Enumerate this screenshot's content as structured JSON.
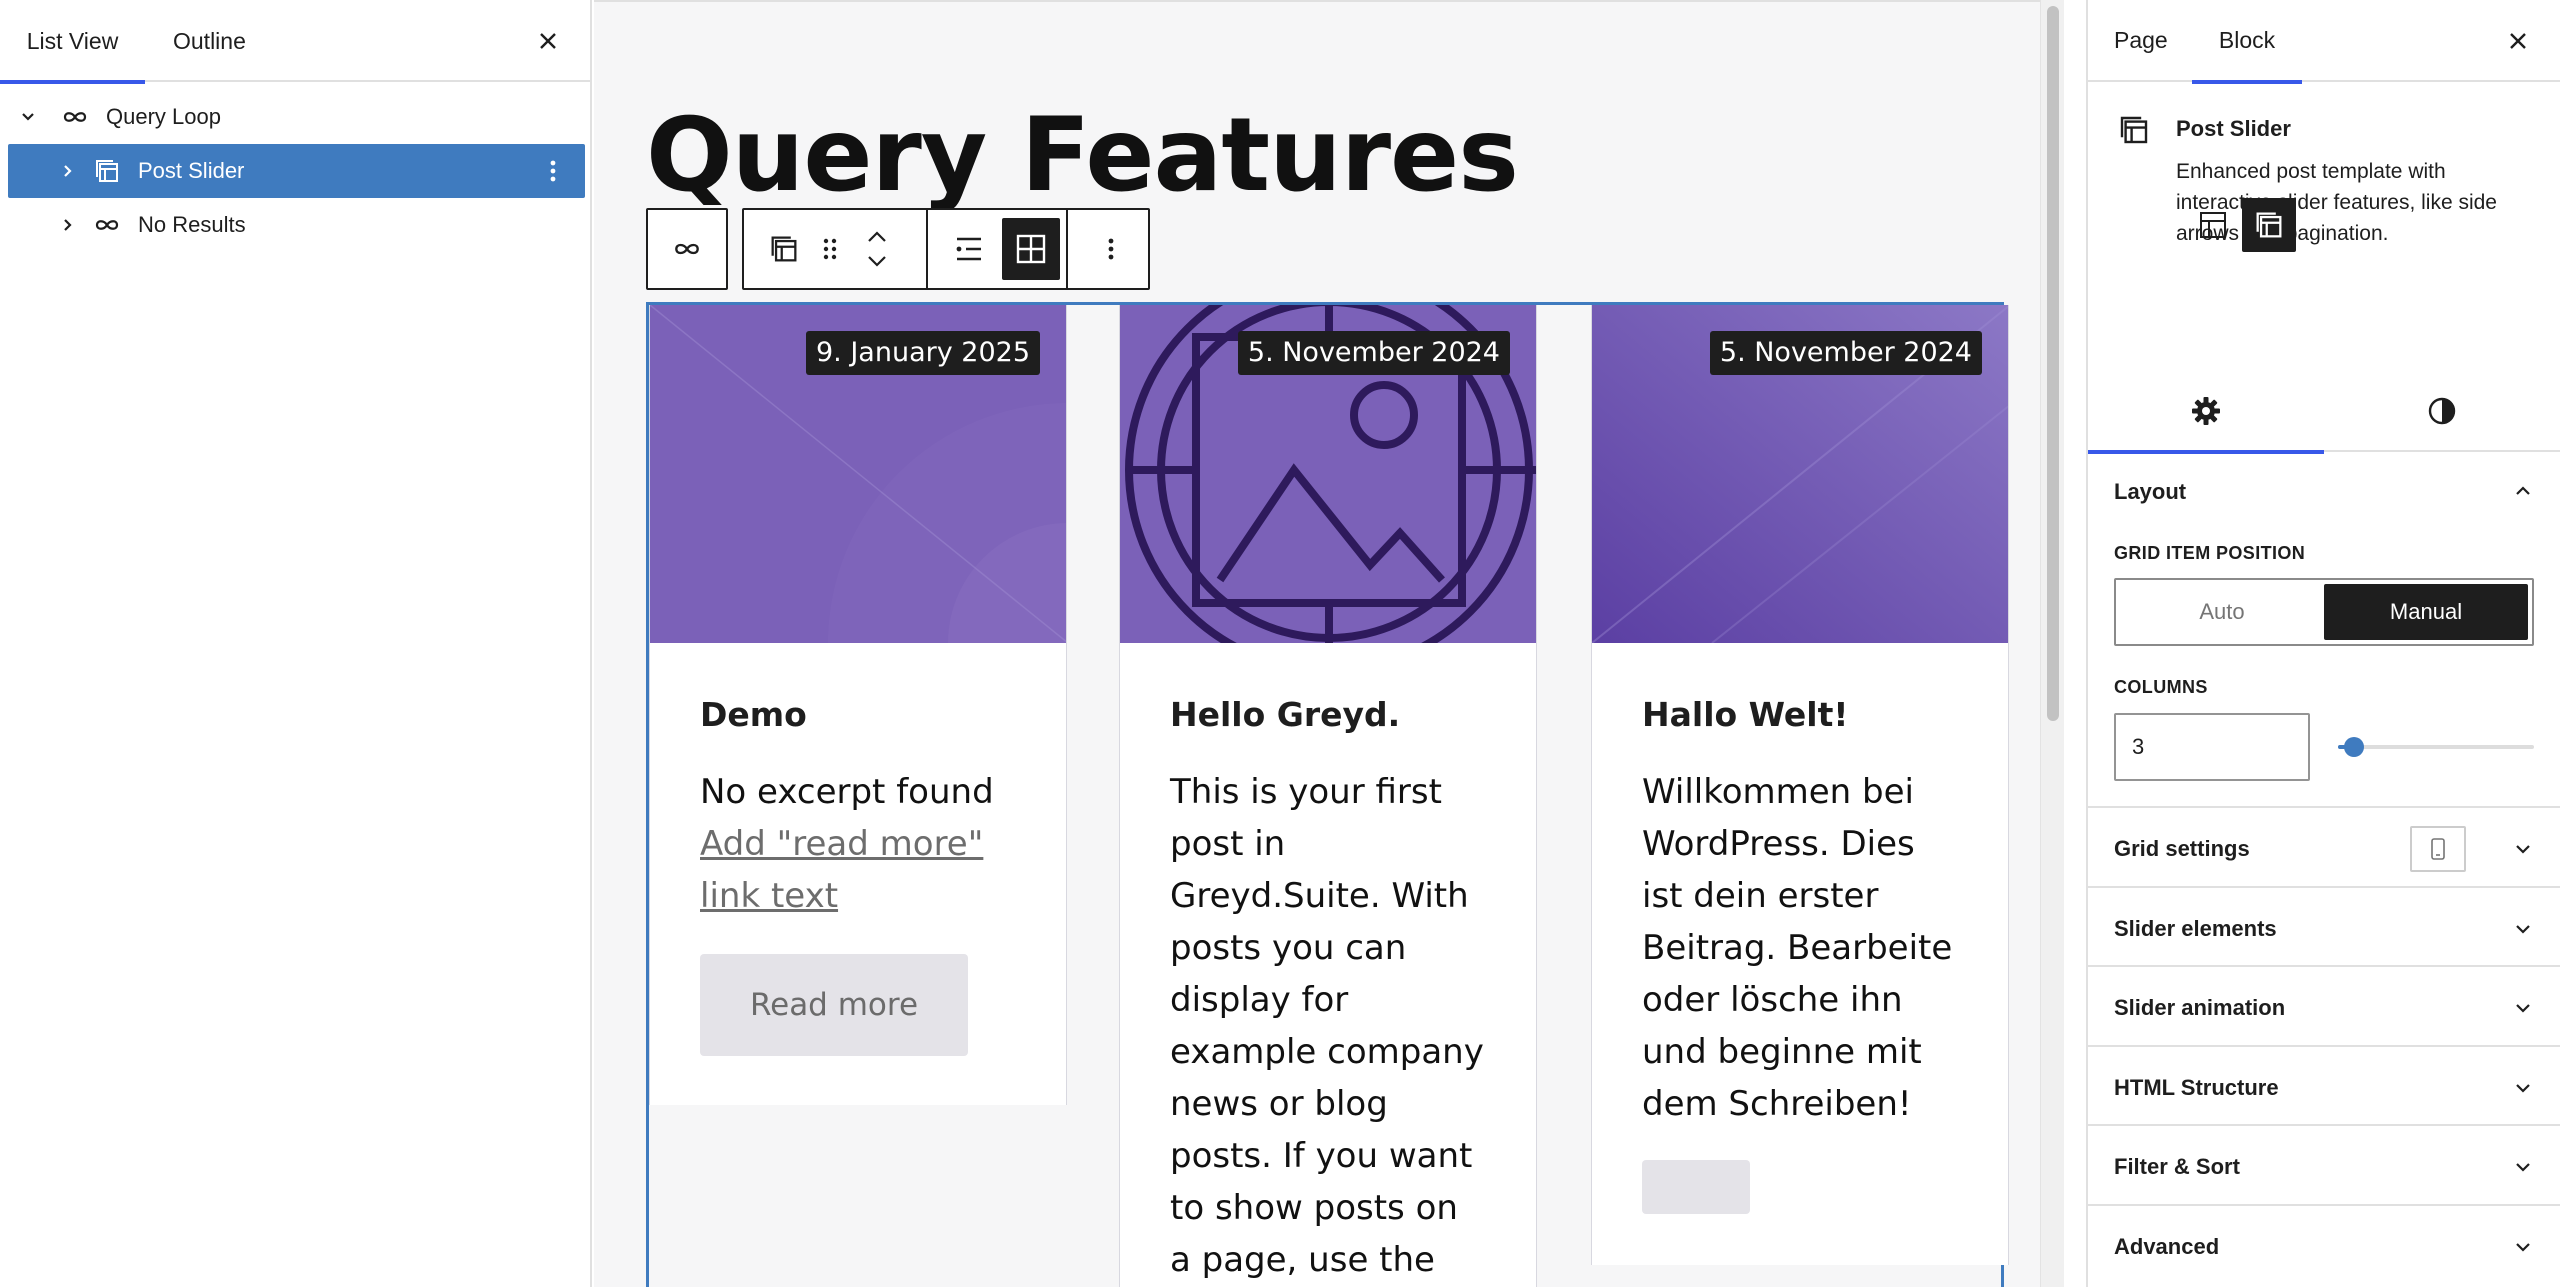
{
  "list_view": {
    "tabs": [
      "List View",
      "Outline"
    ],
    "close_icon": "close-icon",
    "items": [
      {
        "label": "Query Loop",
        "icon": "loop-icon",
        "expanded": true,
        "level": 0
      },
      {
        "label": "Post Slider",
        "icon": "post-slider-icon",
        "expanded": false,
        "level": 1,
        "selected": true
      },
      {
        "label": "No Results",
        "icon": "loop-icon",
        "expanded": false,
        "level": 1
      }
    ]
  },
  "canvas": {
    "page_title": "Query Features",
    "toolbar_icons": [
      "loop-icon",
      "post-slider-icon",
      "drag-handle-icon",
      "move-up-icon",
      "move-down-icon",
      "list-layout-icon",
      "grid-layout-icon",
      "more-options-icon"
    ],
    "posts": [
      {
        "date": "9. January 2025",
        "title": "Demo",
        "excerpt": "No excerpt found",
        "link_text": "Add \"read more\" link text",
        "read_more": "Read more"
      },
      {
        "date": "5. November 2024",
        "title": "Hello Greyd.",
        "excerpt": "This is your first post in Greyd.Suite. With posts you can display for example company news or blog posts. If you want to show posts on a page, use the"
      },
      {
        "date": "5. November 2024",
        "title": "Hallo Welt!",
        "excerpt": "Willkommen bei WordPress. Dies ist dein erster Beitrag. Bearbeite oder lösche ihn und beginne mit dem Schreiben!",
        "read_more": ""
      }
    ]
  },
  "inspector": {
    "tabs": {
      "page": "Page",
      "block": "Block"
    },
    "block": {
      "name": "Post Slider",
      "description": "Enhanced post template with interactive slider features, like side arrows and pagination."
    },
    "settings_tabs": [
      "settings-gear-icon",
      "styles-contrast-icon"
    ],
    "layout": {
      "title": "Layout",
      "grid_item_position_label": "GRID ITEM POSITION",
      "position_options": [
        "Auto",
        "Manual"
      ],
      "selected_position": "Manual",
      "columns_label": "COLUMNS",
      "columns_value": "3",
      "columns_slider_fraction": 0.08
    },
    "panels": [
      "Grid settings",
      "Slider elements",
      "Slider animation",
      "HTML Structure",
      "Filter & Sort",
      "Advanced"
    ]
  },
  "colors": {
    "selection": "#3f7bbf",
    "tab_indicator": "#3858e9",
    "card_image": "#7b61b8",
    "dark": "#1e1e1e"
  }
}
